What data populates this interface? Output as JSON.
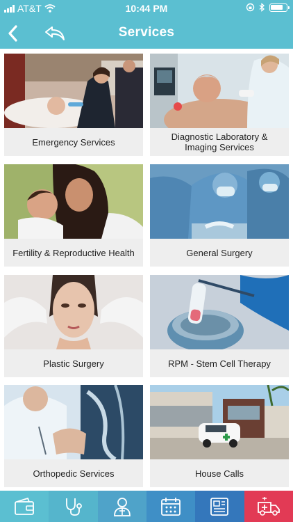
{
  "status_bar": {
    "carrier": "AT&T",
    "time": "10:44 PM"
  },
  "nav": {
    "title": "Services",
    "back_icon": "chevron-left-icon",
    "undo_icon": "undo-arrow-icon"
  },
  "services": [
    {
      "label": "Emergency Services",
      "image": "paramedics-treating-patient"
    },
    {
      "label": "Diagnostic Laboratory & Imaging Services",
      "image": "ultrasound-exam"
    },
    {
      "label": "Fertility & Reproductive Health",
      "image": "mother-kissing-baby"
    },
    {
      "label": "General Surgery",
      "image": "surgeons-operating"
    },
    {
      "label": "Plastic Surgery",
      "image": "woman-face-gloved-hands"
    },
    {
      "label": "RPM - Stem Cell Therapy",
      "image": "test-tube-in-cryo-vial"
    },
    {
      "label": "Orthopedic Services",
      "image": "doctor-viewing-xray"
    },
    {
      "label": "House Calls",
      "image": "clinic-building-with-car"
    }
  ],
  "tabbar": {
    "tabs": [
      {
        "icon": "wallet-icon",
        "color": "#5bbfd1"
      },
      {
        "icon": "stethoscope-icon",
        "color": "#55b5cc"
      },
      {
        "icon": "doctor-icon",
        "color": "#4fa3c9"
      },
      {
        "icon": "calendar-icon",
        "color": "#3f8fc6"
      },
      {
        "icon": "news-icon",
        "color": "#3477bb"
      },
      {
        "icon": "ambulance-icon",
        "color": "#e23a55"
      }
    ]
  },
  "colors": {
    "header": "#5bbfd1",
    "card_background": "#eeeeee"
  }
}
